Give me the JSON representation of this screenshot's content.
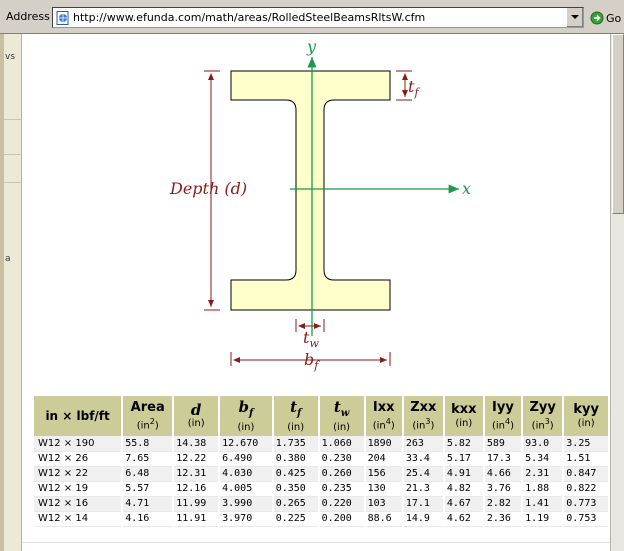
{
  "address_bar": {
    "label": "Address",
    "url": "http://www.efunda.com/math/areas/RolledSteelBeamsRltsW.cfm",
    "go_label": "Go"
  },
  "sidebar": {
    "fragment_1": "vs",
    "fragment_2": "a"
  },
  "diagram": {
    "y_axis_label": "y",
    "x_axis_label": "x",
    "depth_label": "Depth (d)",
    "tf_main": "t",
    "tf_sub": "f",
    "tw_main": "t",
    "tw_sub": "w",
    "bf_main": "b",
    "bf_sub": "f",
    "colors": {
      "beam_fill": "#ffffcc",
      "dimension": "#8b1a1a",
      "axis": "#1a9a4a"
    }
  },
  "table": {
    "header_label": "in × lbf/ft",
    "columns": [
      {
        "main": "Area",
        "unit": "(in",
        "sup": "2",
        "unit_end": ")",
        "italic": false
      },
      {
        "main": "d",
        "sub": "",
        "unit": "(in)",
        "italic": true
      },
      {
        "main": "b",
        "sub": "f",
        "unit": "(in)",
        "italic": true
      },
      {
        "main": "t",
        "sub": "f",
        "unit": "(in)",
        "italic": true
      },
      {
        "main": "t",
        "sub": "w",
        "unit": "(in)",
        "italic": true
      },
      {
        "main": "Ixx",
        "unit": "(in",
        "sup": "4",
        "unit_end": ")",
        "italic": false
      },
      {
        "main": "Zxx",
        "unit": "(in",
        "sup": "3",
        "unit_end": ")",
        "italic": false
      },
      {
        "main": "kxx",
        "unit": "(in)",
        "italic": false
      },
      {
        "main": "Iyy",
        "unit": "(in",
        "sup": "4",
        "unit_end": ")",
        "italic": false
      },
      {
        "main": "Zyy",
        "unit": "(in",
        "sup": "3",
        "unit_end": ")",
        "italic": false
      },
      {
        "main": "kyy",
        "unit": "(in)",
        "italic": false
      }
    ],
    "rows": [
      [
        "W12 × 190",
        "55.8",
        "14.38",
        "12.670",
        "1.735",
        "1.060",
        "1890",
        "263",
        "5.82",
        "589",
        "93.0",
        "3.25"
      ],
      [
        "W12 × 26",
        "7.65",
        "12.22",
        "6.490",
        "0.380",
        "0.230",
        "204",
        "33.4",
        "5.17",
        "17.3",
        "5.34",
        "1.51"
      ],
      [
        "W12 × 22",
        "6.48",
        "12.31",
        "4.030",
        "0.425",
        "0.260",
        "156",
        "25.4",
        "4.91",
        "4.66",
        "2.31",
        "0.847"
      ],
      [
        "W12 × 19",
        "5.57",
        "12.16",
        "4.005",
        "0.350",
        "0.235",
        "130",
        "21.3",
        "4.82",
        "3.76",
        "1.88",
        "0.822"
      ],
      [
        "W12 × 16",
        "4.71",
        "11.99",
        "3.990",
        "0.265",
        "0.220",
        "103",
        "17.1",
        "4.67",
        "2.82",
        "1.41",
        "0.773"
      ],
      [
        "W12 × 14",
        "4.16",
        "11.91",
        "3.970",
        "0.225",
        "0.200",
        "88.6",
        "14.9",
        "4.62",
        "2.36",
        "1.19",
        "0.753"
      ]
    ]
  }
}
